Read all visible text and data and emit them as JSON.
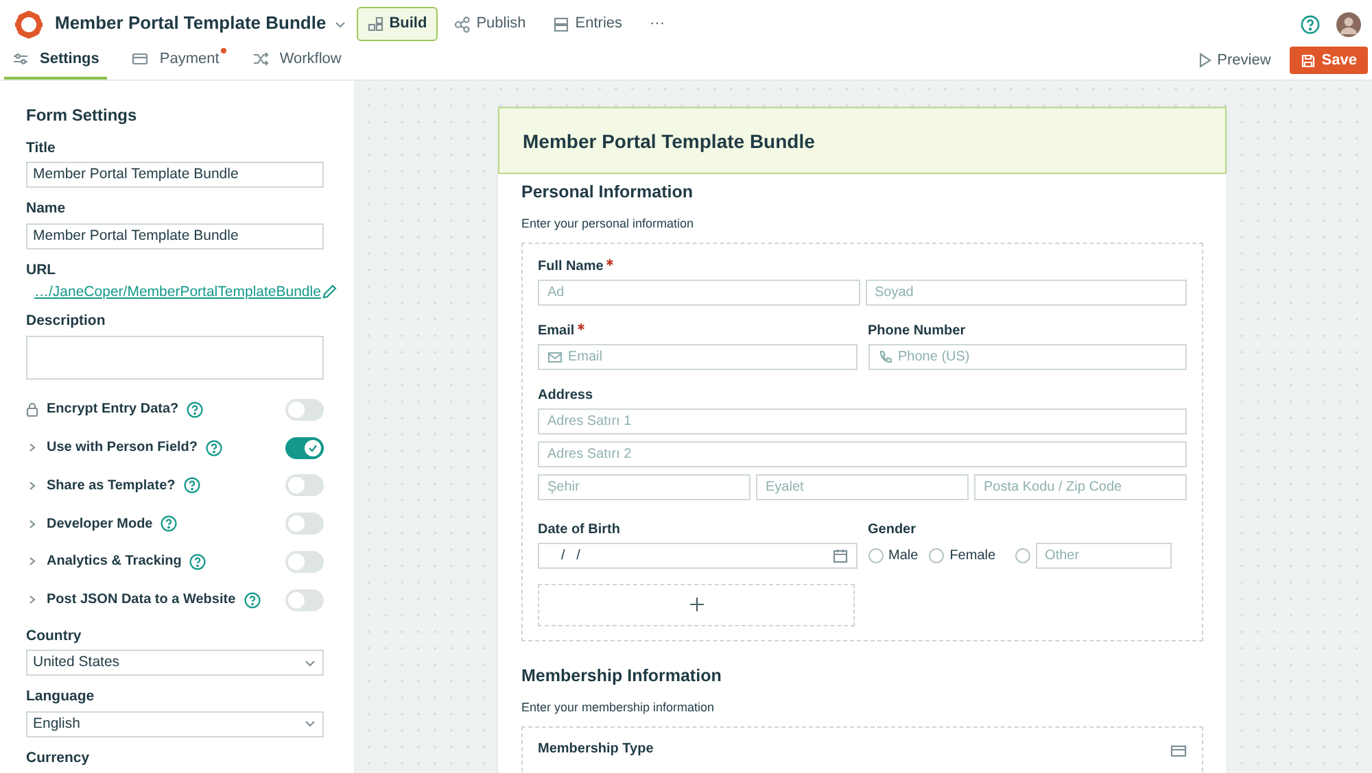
{
  "app": {
    "title": "Member Portal Template Bundle",
    "more": "···"
  },
  "main_tabs": [
    {
      "label": "Build",
      "kind": "build",
      "selected": true
    },
    {
      "label": "Publish",
      "kind": "publish",
      "selected": false
    },
    {
      "label": "Entries",
      "kind": "entries",
      "selected": false
    }
  ],
  "sub_tabs": [
    {
      "label": "Settings",
      "kind": "settings",
      "selected": true,
      "badge": false
    },
    {
      "label": "Payment",
      "kind": "payment",
      "selected": false,
      "badge": true
    },
    {
      "label": "Workflow",
      "kind": "workflow",
      "selected": false,
      "badge": false
    }
  ],
  "actions": {
    "preview": "Preview",
    "save": "Save"
  },
  "settings": {
    "heading": "Form Settings",
    "fields": [
      {
        "label": "Title",
        "value": "Member Portal Template Bundle"
      },
      {
        "label": "Name",
        "value": "Member Portal Template Bundle"
      }
    ],
    "url": {
      "label": "URL",
      "link": "…/JaneCoper/MemberPortalTemplateBundle"
    },
    "description": {
      "label": "Description"
    },
    "toggles": [
      {
        "label": "Encrypt Entry Data?",
        "kind": "lock",
        "on": false
      },
      {
        "label": "Use with Person Field?",
        "kind": "expand",
        "on": true
      },
      {
        "label": "Share as Template?",
        "kind": "expand",
        "on": false
      },
      {
        "label": "Developer Mode",
        "kind": "expand",
        "on": false
      },
      {
        "label": "Analytics & Tracking",
        "kind": "expand",
        "on": false
      },
      {
        "label": "Post JSON Data to a Website",
        "kind": "expand",
        "on": false
      }
    ],
    "selects": [
      {
        "label": "Country",
        "value": "United States"
      },
      {
        "label": "Language",
        "value": "English"
      }
    ],
    "currency_label": "Currency"
  },
  "form": {
    "title": "Member Portal Template Bundle",
    "sections": [
      {
        "title": "Personal Information",
        "subtitle": "Enter your personal information",
        "rows": [
          [
            {
              "kind": "name",
              "label": "Full Name",
              "required": true,
              "placeholders": [
                "Ad",
                "Soyad"
              ]
            }
          ],
          [
            {
              "kind": "email",
              "label": "Email",
              "required": true,
              "placeholder": "Email"
            },
            {
              "kind": "phone",
              "label": "Phone Number",
              "required": false,
              "placeholder": "Phone (US)"
            }
          ],
          [
            {
              "kind": "address",
              "label": "Address",
              "required": false,
              "lines": [
                "Adres Satırı 1",
                "Adres Satırı 2"
              ],
              "parts": [
                "Şehir",
                "Eyalet",
                "Posta Kodu / Zip Code"
              ]
            }
          ],
          [
            {
              "kind": "date",
              "label": "Date of Birth",
              "required": false,
              "value": "/   /"
            },
            {
              "kind": "radio",
              "label": "Gender",
              "required": false,
              "options": [
                {
                  "label": "Male",
                  "selected": false
                },
                {
                  "label": "Female",
                  "selected": false
                }
              ],
              "other": {
                "placeholder": "Other",
                "selected": false
              }
            }
          ],
          [
            {
              "kind": "add"
            }
          ]
        ]
      },
      {
        "title": "Membership Information",
        "subtitle": "Enter your membership information",
        "rows": [
          [
            {
              "kind": "payment",
              "label": "Membership Type",
              "required": false
            }
          ]
        ]
      }
    ]
  }
}
